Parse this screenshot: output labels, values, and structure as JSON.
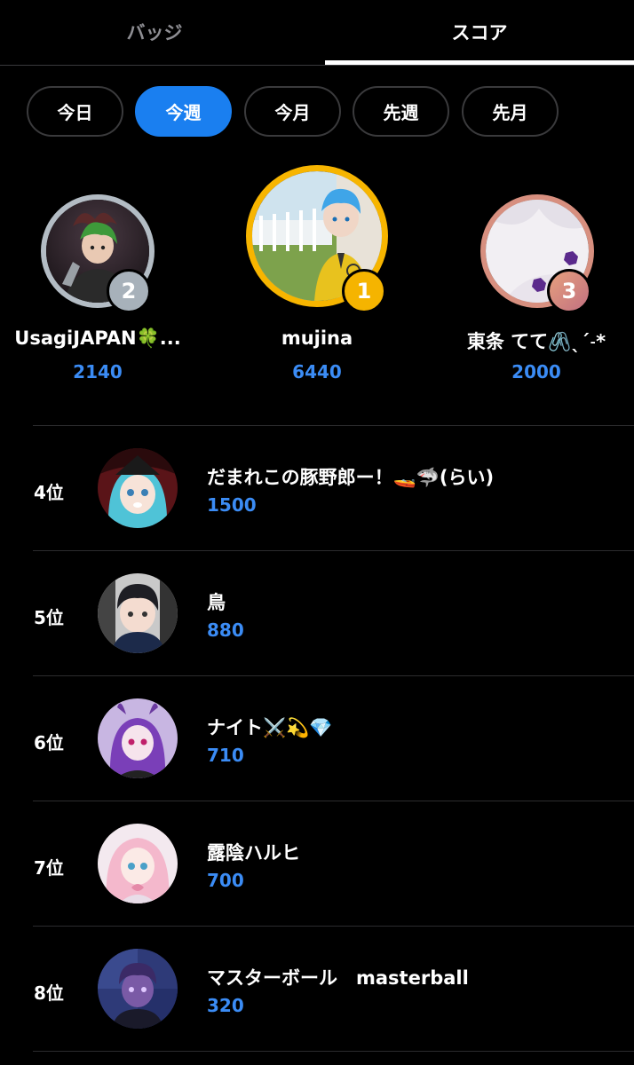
{
  "tabs": {
    "badges_label": "バッジ",
    "score_label": "スコア",
    "active": "score"
  },
  "filters": {
    "items": [
      "今日",
      "今週",
      "今月",
      "先週",
      "先月"
    ],
    "selected": "今週"
  },
  "colors": {
    "accent": "#1a7ff0",
    "score_text": "#3b8cf5",
    "gold": "#f7b500",
    "silver": "#b3bcc4",
    "bronze": "#d78f7f",
    "background": "#000000"
  },
  "podium": {
    "first": {
      "rank": "1",
      "name": "mujina",
      "score": "6440",
      "avatar_icon": "user-avatar-icon"
    },
    "second": {
      "rank": "2",
      "name": "UsagiJAPAN🍀...",
      "score": "2140",
      "avatar_icon": "user-avatar-icon"
    },
    "third": {
      "rank": "3",
      "name": "東条 てて🖇️ˎˊ˗*",
      "score": "2000",
      "avatar_icon": "user-avatar-icon"
    }
  },
  "ranking": [
    {
      "rank_label": "4位",
      "name": "だまれこの豚野郎ー！🚤🦈(らい)",
      "score": "1500",
      "avatar_icon": "user-avatar-icon"
    },
    {
      "rank_label": "5位",
      "name": "鳥",
      "score": "880",
      "avatar_icon": "user-avatar-icon"
    },
    {
      "rank_label": "6位",
      "name": "ナイト⚔️💫💎",
      "score": "710",
      "avatar_icon": "user-avatar-icon"
    },
    {
      "rank_label": "7位",
      "name": "露陰ハルヒ",
      "score": "700",
      "avatar_icon": "user-avatar-icon"
    },
    {
      "rank_label": "8位",
      "name": "マスターボール　masterball",
      "score": "320",
      "avatar_icon": "user-avatar-icon"
    }
  ]
}
